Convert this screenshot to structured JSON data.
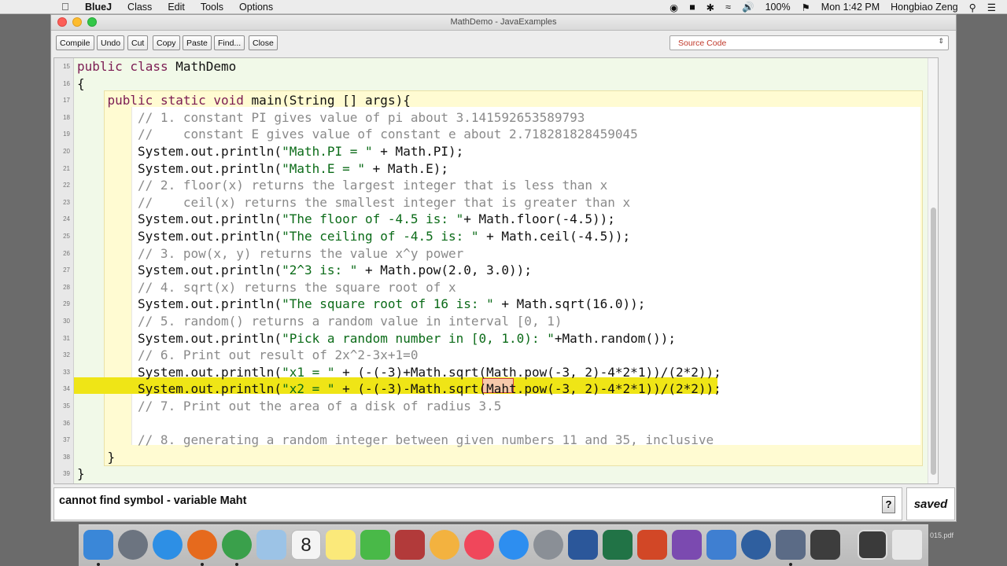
{
  "menubar": {
    "app": "BlueJ",
    "items": [
      "Class",
      "Edit",
      "Tools",
      "Options"
    ],
    "battery": "100%",
    "clock": "Mon 1:42 PM",
    "user": "Hongbiao Zeng"
  },
  "window": {
    "title": "MathDemo - JavaExamples"
  },
  "toolbar": {
    "compile": "Compile",
    "undo": "Undo",
    "cut": "Cut",
    "copy": "Copy",
    "paste": "Paste",
    "find": "Find...",
    "close": "Close",
    "view_select": "Source Code"
  },
  "editor": {
    "lines": [
      {
        "n": "15",
        "indent": 0,
        "parts": [
          [
            "kw",
            "public class "
          ],
          [
            "tx",
            "MathDemo"
          ]
        ]
      },
      {
        "n": "16",
        "indent": 0,
        "parts": [
          [
            "tx",
            "{"
          ]
        ]
      },
      {
        "n": "17",
        "indent": 4,
        "parts": [
          [
            "kw",
            "public static void "
          ],
          [
            "tx",
            "main(String [] args){"
          ]
        ]
      },
      {
        "n": "18",
        "indent": 8,
        "parts": [
          [
            "cm",
            "// 1. constant PI gives value of pi about 3.141592653589793"
          ]
        ]
      },
      {
        "n": "19",
        "indent": 8,
        "parts": [
          [
            "cm",
            "//    constant E gives value of constant e about 2.718281828459045"
          ]
        ]
      },
      {
        "n": "20",
        "indent": 8,
        "parts": [
          [
            "tx",
            "System.out.println("
          ],
          [
            "st",
            "\"Math.PI = \""
          ],
          [
            "tx",
            " + Math.PI);"
          ]
        ]
      },
      {
        "n": "21",
        "indent": 8,
        "parts": [
          [
            "tx",
            "System.out.println("
          ],
          [
            "st",
            "\"Math.E = \""
          ],
          [
            "tx",
            " + Math.E);"
          ]
        ]
      },
      {
        "n": "22",
        "indent": 8,
        "parts": [
          [
            "cm",
            "// 2. floor(x) returns the largest integer that is less than x"
          ]
        ]
      },
      {
        "n": "23",
        "indent": 8,
        "parts": [
          [
            "cm",
            "//    ceil(x) returns the smallest integer that is greater than x"
          ]
        ]
      },
      {
        "n": "24",
        "indent": 8,
        "parts": [
          [
            "tx",
            "System.out.println("
          ],
          [
            "st",
            "\"The floor of -4.5 is: \""
          ],
          [
            "tx",
            "+ Math.floor(-4.5));"
          ]
        ]
      },
      {
        "n": "25",
        "indent": 8,
        "parts": [
          [
            "tx",
            "System.out.println("
          ],
          [
            "st",
            "\"The ceiling of -4.5 is: \""
          ],
          [
            "tx",
            " + Math.ceil(-4.5));"
          ]
        ]
      },
      {
        "n": "26",
        "indent": 8,
        "parts": [
          [
            "cm",
            "// 3. pow(x, y) returns the value x^y power"
          ]
        ]
      },
      {
        "n": "27",
        "indent": 8,
        "parts": [
          [
            "tx",
            "System.out.println("
          ],
          [
            "st",
            "\"2^3 is: \""
          ],
          [
            "tx",
            " + Math.pow(2.0, 3.0));"
          ]
        ]
      },
      {
        "n": "28",
        "indent": 8,
        "parts": [
          [
            "cm",
            "// 4. sqrt(x) returns the square root of x"
          ]
        ]
      },
      {
        "n": "29",
        "indent": 8,
        "parts": [
          [
            "tx",
            "System.out.println("
          ],
          [
            "st",
            "\"The square root of 16 is: \""
          ],
          [
            "tx",
            " + Math.sqrt(16.0));"
          ]
        ]
      },
      {
        "n": "30",
        "indent": 8,
        "parts": [
          [
            "cm",
            "// 5. random() returns a random value in interval [0, 1)"
          ]
        ]
      },
      {
        "n": "31",
        "indent": 8,
        "parts": [
          [
            "tx",
            "System.out.println("
          ],
          [
            "st",
            "\"Pick a random number in [0, 1.0): \""
          ],
          [
            "tx",
            "+Math.random());"
          ]
        ]
      },
      {
        "n": "32",
        "indent": 8,
        "parts": [
          [
            "cm",
            "// 6. Print out result of 2x^2-3x+1=0"
          ]
        ]
      },
      {
        "n": "33",
        "indent": 8,
        "parts": [
          [
            "tx",
            "System.out.println("
          ],
          [
            "st",
            "\"x1 = \""
          ],
          [
            "tx",
            " + (-(-3)+Math.sqrt(Math.pow(-3, 2)-4*2*1))/(2*2));"
          ]
        ]
      },
      {
        "n": "34",
        "indent": 8,
        "parts": [
          [
            "tx",
            "System.out.println("
          ],
          [
            "st",
            "\"x2 = \""
          ],
          [
            "tx",
            " + (-(-3)-Math.sqrt(Maht.pow(-3, 2)-4*2*1))/(2*2));"
          ]
        ]
      },
      {
        "n": "35",
        "indent": 8,
        "parts": [
          [
            "cm",
            "// 7. Print out the area of a disk of radius 3.5"
          ]
        ]
      },
      {
        "n": "36",
        "indent": 8,
        "parts": []
      },
      {
        "n": "37",
        "indent": 8,
        "parts": [
          [
            "cm",
            "// 8. generating a random integer between given numbers 11 and 35, inclusive"
          ]
        ]
      },
      {
        "n": "38",
        "indent": 4,
        "parts": [
          [
            "tx",
            "}"
          ]
        ]
      },
      {
        "n": "39",
        "indent": 0,
        "parts": [
          [
            "tx",
            "}"
          ]
        ]
      }
    ]
  },
  "status": {
    "message": "cannot find symbol -   variable Maht",
    "help": "?",
    "saved": "saved"
  },
  "dock": {
    "calendar_day": "8",
    "side_file_label": "015.pdf"
  }
}
